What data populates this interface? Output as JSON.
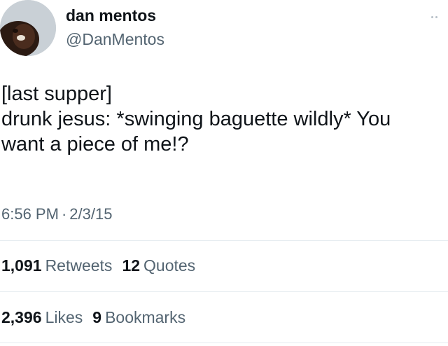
{
  "author": {
    "display_name": "dan mentos",
    "handle": "@DanMentos"
  },
  "tweet": {
    "lines": [
      "[last supper]",
      "drunk jesus: *swinging baguette wildly* You",
      "want a piece of me!?"
    ],
    "time": "6:56 PM",
    "separator": "·",
    "date": "2/3/15"
  },
  "stats": {
    "retweets": {
      "count": "1,091",
      "label": "Retweets"
    },
    "quotes": {
      "count": "12",
      "label": "Quotes"
    },
    "likes": {
      "count": "2,396",
      "label": "Likes"
    },
    "bookmarks": {
      "count": "9",
      "label": "Bookmarks"
    }
  },
  "icons": {
    "more": "more-options-icon",
    "avatar": "avatar"
  },
  "colors": {
    "text": "#0f1419",
    "muted": "#536471",
    "divider": "#e6ecf0"
  }
}
